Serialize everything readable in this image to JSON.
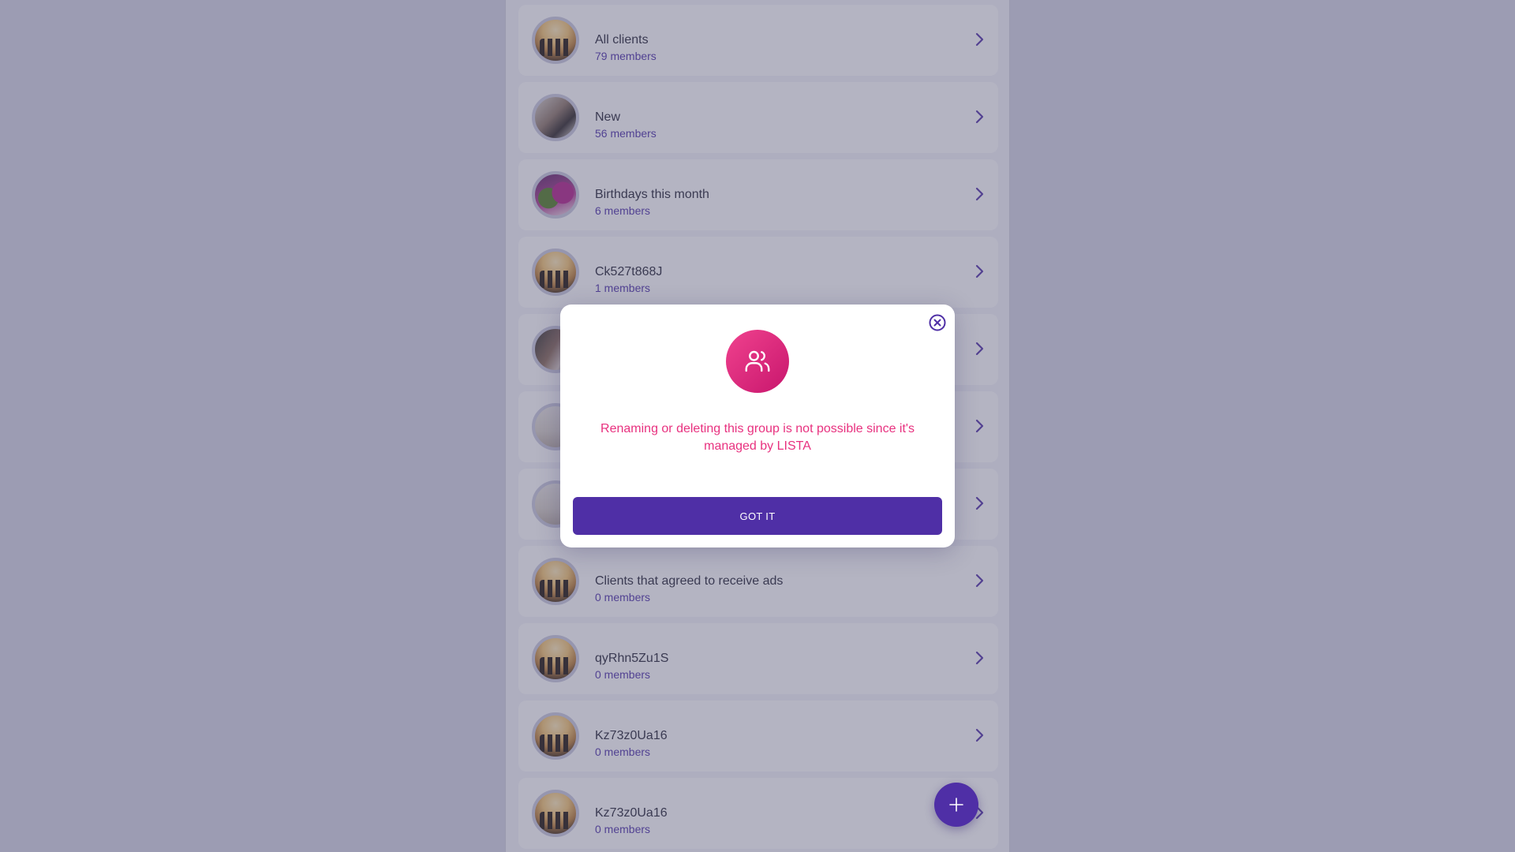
{
  "groups": [
    {
      "name": "",
      "count": "",
      "avatar": "group-photo"
    },
    {
      "name": "All clients",
      "count": "79 members",
      "avatar": "group-photo"
    },
    {
      "name": "New",
      "count": "56 members",
      "avatar": "meeting-photo"
    },
    {
      "name": "Birthdays this month",
      "count": "6 members",
      "avatar": "balloons-photo"
    },
    {
      "name": "Ck527t868J",
      "count": "1 members",
      "avatar": "group-photo"
    },
    {
      "name": "",
      "count": "",
      "avatar": "handshake-photo"
    },
    {
      "name": "",
      "count": "",
      "avatar": "bicycle-photo"
    },
    {
      "name": "",
      "count": "",
      "avatar": "bicycle-photo"
    },
    {
      "name": "Clients that agreed to receive ads",
      "count": "0 members",
      "avatar": "group-photo"
    },
    {
      "name": "qyRhn5Zu1S",
      "count": "0 members",
      "avatar": "group-photo"
    },
    {
      "name": "Kz73z0Ua16",
      "count": "0 members",
      "avatar": "group-photo"
    },
    {
      "name": "Kz73z0Ua16",
      "count": "0 members",
      "avatar": "group-photo"
    }
  ],
  "modal": {
    "icon": "users-icon",
    "message": "Renaming or deleting this group is not possible since it's managed by LISTA",
    "button_label": "GOT IT",
    "close_icon": "close-circle-icon"
  },
  "fab": {
    "icon": "plus-icon"
  },
  "colors": {
    "accent": "#4f2fa6",
    "pink": "#e8317f",
    "count_text": "#4b2fa8"
  }
}
